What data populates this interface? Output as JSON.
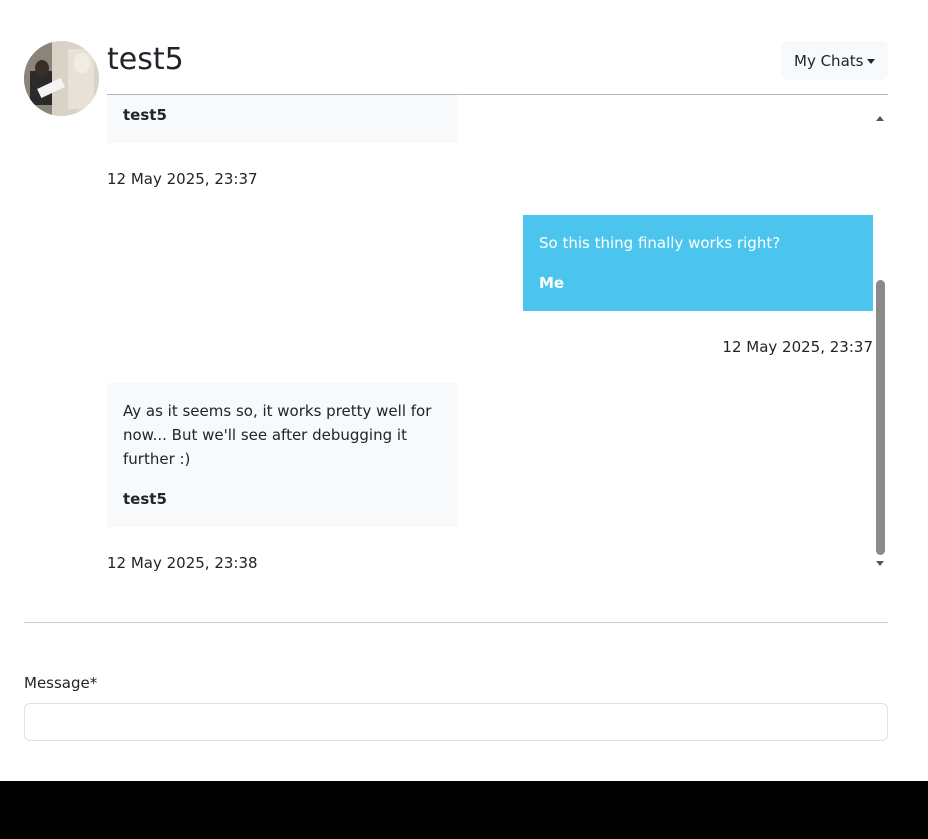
{
  "chat": {
    "title": "test5",
    "avatar_alt": "test5 avatar"
  },
  "nav": {
    "dropdown_label": "My Chats"
  },
  "messages": [
    {
      "direction": "in",
      "text": "",
      "author": "test5",
      "timestamp": "12 May 2025, 23:37"
    },
    {
      "direction": "out",
      "text": "So this thing finally works right?",
      "author": "Me",
      "timestamp": "12 May 2025, 23:37"
    },
    {
      "direction": "in",
      "text_lines": [
        "Ay as it seems so, it works pretty well for",
        "now... But we'll see after debugging it",
        "further :)"
      ],
      "author": "test5",
      "timestamp": "12 May 2025, 23:38"
    }
  ],
  "form": {
    "message_label": "Message*",
    "message_value": "",
    "message_placeholder": ""
  },
  "colors": {
    "outgoing_bubble": "#4bc5ed",
    "incoming_bubble": "#f8f9fa"
  }
}
